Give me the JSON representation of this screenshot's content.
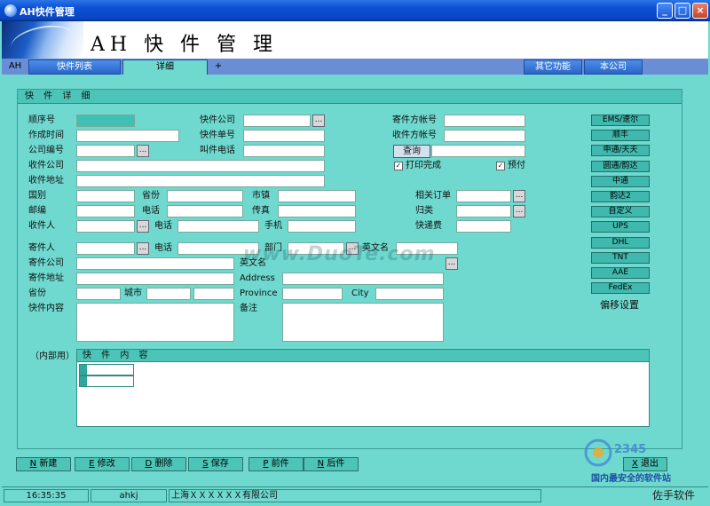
{
  "window": {
    "title": "AH快件管理"
  },
  "banner": {
    "name": "AH 快 件 管 理"
  },
  "tabs": {
    "home": "AH",
    "list": "快件列表",
    "detail": "详细",
    "add": "+",
    "other": "其它功能",
    "company": "本公司"
  },
  "panel": {
    "title": "快 件 详 细"
  },
  "fields": {
    "seq": "顺序号",
    "created": "作成时间",
    "company_no": "公司编号",
    "recv_company": "收件公司",
    "recv_addr": "收件地址",
    "express_co": "快件公司",
    "tracking_no": "快件单号",
    "call_phone": "叫件电话",
    "sender_acct": "寄件方帐号",
    "recv_acct": "收件方帐号",
    "query_btn": "查询",
    "print_done": "打印完成",
    "prepaid": "预付",
    "country": "国别",
    "province": "省份",
    "town": "市镇",
    "postcode": "邮编",
    "phone": "电话",
    "fax": "传真",
    "receiver": "收件人",
    "phone2": "电话",
    "mobile": "手机",
    "related_order": "相关订单",
    "category": "归类",
    "express_fee": "快递费",
    "sender": "寄件人",
    "sender_phone": "电话",
    "dept": "部门",
    "en_name": "英文名",
    "sender_company": "寄件公司",
    "en_name2": "英文名",
    "sender_addr": "寄件地址",
    "address": "Address",
    "province2": "省份",
    "city": "城市",
    "province_en": "Province",
    "city_en": "City",
    "content": "快件内容",
    "remark": "备注",
    "internal": "（内部用）",
    "content_inner": "快 件 内 容"
  },
  "carriers": [
    "EMS/速尔",
    "顺丰",
    "申通/天天",
    "圆通/韵达",
    "中通",
    "韵达2",
    "自定义",
    "UPS",
    "DHL",
    "TNT",
    "AAE",
    "FedEx"
  ],
  "offset_label": "偏移设置",
  "actions": {
    "new_key": "N",
    "new": "新建",
    "edit_key": "E",
    "edit": "修改",
    "del_key": "D",
    "del": "删除",
    "save_key": "S",
    "save": "保存",
    "prev_key": "P",
    "prev": "前件",
    "next_key": "N",
    "next": "后件",
    "exit_key": "X",
    "exit": "退出"
  },
  "status": {
    "time": "16:35:35",
    "user": "ahkj",
    "company": "上海ＸＸＸＸＸＸ有限公司"
  },
  "watermark": "www.DuoTe.com",
  "corner": {
    "site": "国内最安全的软件站",
    "brand": "佐手软件"
  },
  "colors": {
    "background": "#6fd9cf",
    "header": "#4cc4b8",
    "titlebar": "#0a4fd4",
    "carrier_btn": "#3fb8ad"
  }
}
